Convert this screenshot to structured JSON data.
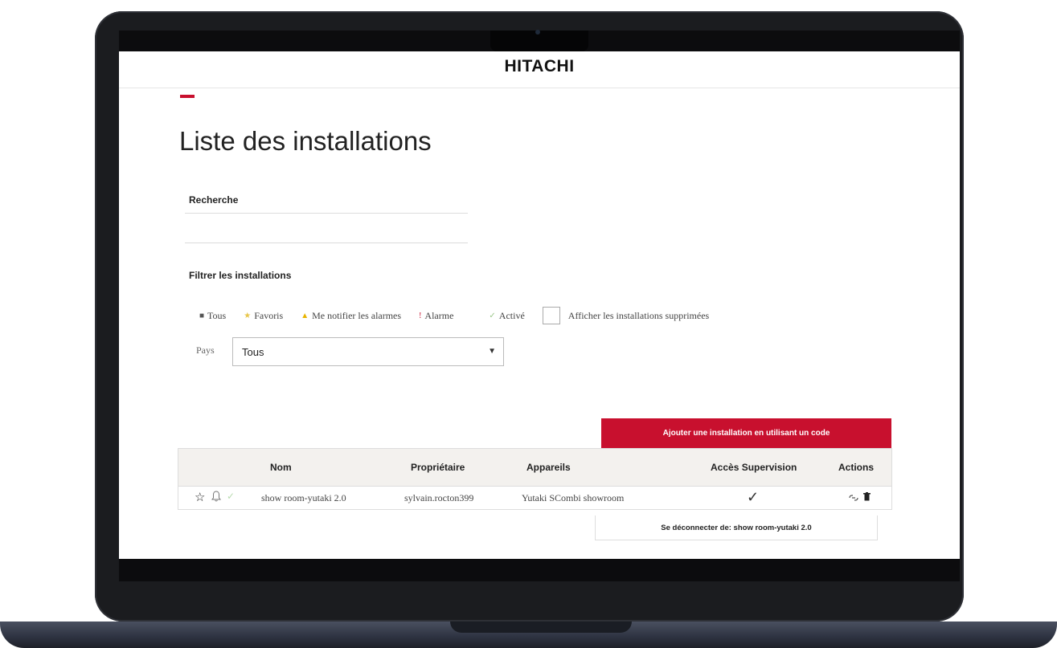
{
  "app": {
    "logo": "HITACHI",
    "page_title": "Liste des installations"
  },
  "search": {
    "label": "Recherche",
    "value": "",
    "placeholder": ""
  },
  "filters": {
    "label": "Filtrer les installations",
    "items": [
      {
        "label": "Tous",
        "dot": "■",
        "color": "#555555"
      },
      {
        "label": "Favoris",
        "dot": "★",
        "color": "#e8c64a"
      },
      {
        "label": "Me notifier les alarmes",
        "dot": "▲",
        "color": "#e8b400"
      },
      {
        "label": "Alarme",
        "dot": "!",
        "color": "#c8102e"
      },
      {
        "label": "Activé",
        "dot": "✓",
        "color": "#9bc78a"
      }
    ],
    "show_deleted_label": "Afficher les installations supprimées",
    "show_deleted_checked": false
  },
  "country": {
    "label": "Pays",
    "selected": "Tous"
  },
  "add_button": {
    "label": "Ajouter une installation en utilisant un code"
  },
  "table": {
    "columns": [
      "Nom",
      "Propriétaire",
      "Appareils",
      "Accès Supervision",
      "Actions"
    ],
    "rows": [
      {
        "nom": "show room-yutaki 2.0",
        "proprietaire": "sylvain.rocton399",
        "appareils": "Yutaki SCombi showroom",
        "acces_supervision": "✓",
        "favorite_icon": "star-outline-icon",
        "bell_icon": "bell-icon",
        "status_icon": "check-icon",
        "actions": [
          "unlink-icon",
          "trash-icon"
        ]
      }
    ]
  },
  "disconnect": {
    "label": "Se déconnecter de: show room-yutaki 2.0"
  },
  "colors": {
    "accent": "#c8102e",
    "table_header_bg": "#f3f1ee"
  }
}
